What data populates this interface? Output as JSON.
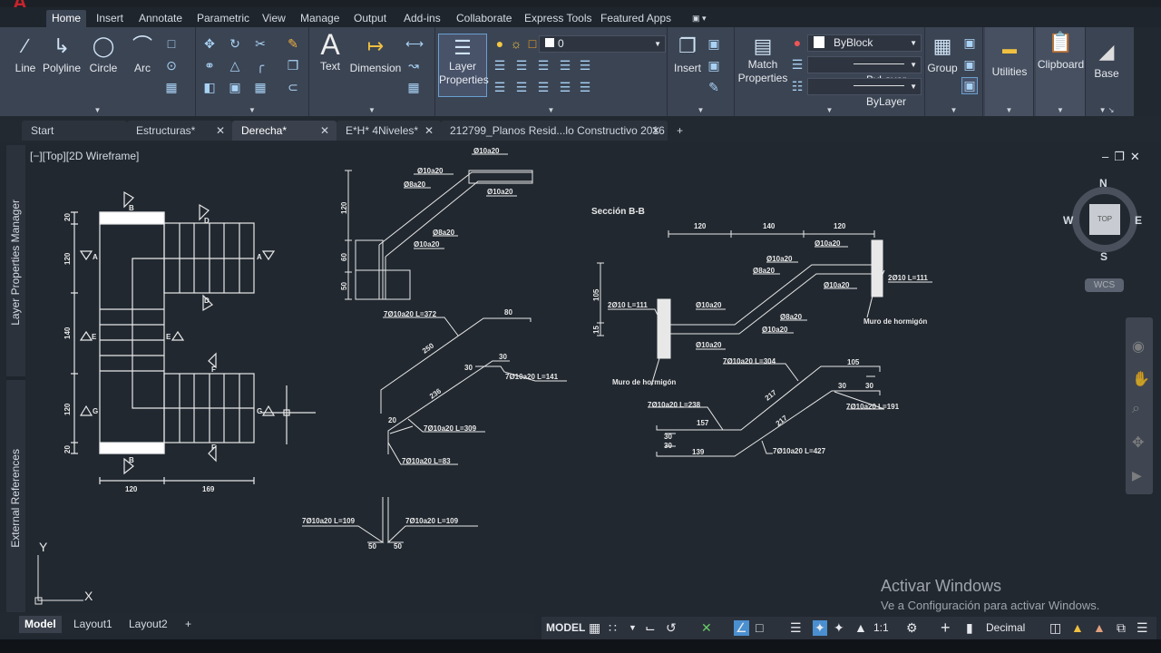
{
  "app": {
    "logo": "A"
  },
  "ribbon_tabs": [
    "Home",
    "Insert",
    "Annotate",
    "Parametric",
    "View",
    "Manage",
    "Output",
    "Add-ins",
    "Collaborate",
    "Express Tools",
    "Featured Apps"
  ],
  "ribbon": {
    "draw": {
      "line": "Line",
      "polyline": "Polyline",
      "circle": "Circle",
      "arc": "Arc"
    },
    "annotation": {
      "text": "Text",
      "dimension": "Dimension"
    },
    "layers": {
      "layer_properties": "Layer Properties",
      "current_layer": "0"
    },
    "block": {
      "insert": "Insert"
    },
    "properties": {
      "match_properties": "Match Properties",
      "color": "ByBlock",
      "linetype": "ByLayer",
      "lineweight": "ByLayer"
    },
    "groups": {
      "group": "Group"
    },
    "utilities": "Utilities",
    "clipboard": "Clipboard",
    "base": "Base"
  },
  "doc_tabs": [
    {
      "label": "Start",
      "closable": false
    },
    {
      "label": "Estructuras*",
      "closable": true
    },
    {
      "label": "Derecha*",
      "closable": true,
      "active": true
    },
    {
      "label": "E*H* 4Niveles*",
      "closable": true
    },
    {
      "label": "212799_Planos Resid...lo Constructivo 2016",
      "closable": true
    }
  ],
  "palettes": {
    "layer_manager": "Layer Properties Manager",
    "external_refs": "External References"
  },
  "viewport": {
    "label": "[−][Top][2D Wireframe]"
  },
  "viewcube": {
    "n": "N",
    "s": "S",
    "e": "E",
    "w": "W",
    "face": "TOP",
    "wcs": "WCS"
  },
  "ucs": {
    "x": "X",
    "y": "Y"
  },
  "drawing": {
    "plan": {
      "dims_v": [
        "20",
        "120",
        "140",
        "120",
        "20"
      ],
      "dims_h": [
        "120",
        "169"
      ],
      "marks": [
        "A",
        "A",
        "E",
        "E",
        "G",
        "G",
        "B",
        "B",
        "D",
        "D",
        "F",
        "F"
      ]
    },
    "section_a": {
      "dims": [
        "120",
        "60",
        "50"
      ],
      "labels": [
        "Ø10a20",
        "Ø10a20",
        "Ø8a20",
        "Ø10a20",
        "Ø8a20",
        "Ø10a20"
      ]
    },
    "bars_a": [
      "7Ø10a20 L=372",
      "7Ø10a20 L=141",
      "7Ø10a20 L=309",
      "7Ø10a20 L=83",
      "7Ø10a20 L=109",
      "7Ø10a20 L=109"
    ],
    "bars_a_nums": [
      "250",
      "80",
      "236",
      "30",
      "20",
      "30",
      "50",
      "50"
    ],
    "section_b": {
      "title": "Sección B-B",
      "dims": [
        "120",
        "140",
        "120",
        "105",
        "15"
      ],
      "labels": [
        "2Ø10 L=111",
        "Ø10a20",
        "Ø10a20",
        "Ø8a20",
        "Ø10a20",
        "Ø10a20",
        "Ø10a20",
        "Ø8a20",
        "Ø10a20",
        "2Ø10 L=111"
      ],
      "wall": "Muro de hormigón"
    },
    "bars_b": [
      "7Ø10a20 L=304",
      "7Ø10a20 L=238",
      "7Ø10a20 L=191",
      "7Ø10a20 L=427"
    ],
    "bars_b_nums": [
      "105",
      "217",
      "217",
      "157",
      "139",
      "30",
      "30",
      "30",
      "30"
    ]
  },
  "layout_tabs": [
    "Model",
    "Layout1",
    "Layout2"
  ],
  "status": {
    "model": "MODEL",
    "scale": "1:1",
    "units": "Decimal"
  },
  "watermark": {
    "line1": "Activar Windows",
    "line2": "Ve a Configuración para activar Windows."
  }
}
